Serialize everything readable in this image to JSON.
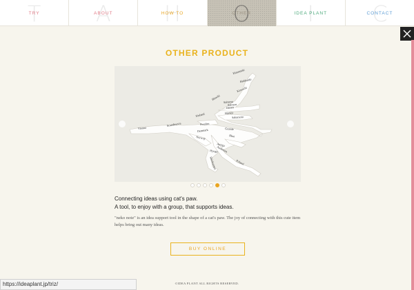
{
  "nav": {
    "items": [
      {
        "letter": "T",
        "label": "TRY",
        "color": "#e07a86"
      },
      {
        "letter": "A",
        "label": "ABOUT",
        "color": "#e07a86"
      },
      {
        "letter": "H",
        "label": "HOW TO",
        "color": "#e9a520"
      },
      {
        "letter": "O",
        "label": "OTHER",
        "color": "#9a9281"
      },
      {
        "letter": "I",
        "label": "IDEA PLANT",
        "color": "#4aa87a"
      },
      {
        "letter": "C",
        "label": "CONTACT",
        "color": "#5a9bd4"
      }
    ],
    "active_index": 3
  },
  "close_icon": "close-x-icon",
  "heading": "OTHER PRODUCT",
  "colors": {
    "accent": "#e9b21c",
    "edge": "#e58c9a"
  },
  "slider": {
    "dots": 6,
    "active_dot": 5,
    "words": [
      "Hanamaki",
      "Hokkaido",
      "Hitachi",
      "Kawachi",
      "Saitama",
      "Himeji",
      "Onsen",
      "Salmon",
      "Sakamoto",
      "Finland",
      "Scandinavia",
      "Sweden",
      "Denmark",
      "Norway",
      "Grande",
      "Blue",
      "Amiga",
      "Andersen",
      "Hyogo",
      "Poland",
      "Shinkansen",
      "Vienna"
    ]
  },
  "product": {
    "tagline_1": "Connecting ideas using cat's paw.",
    "tagline_2": "A tool, to enjoy with a group, that supports ideas.",
    "description": "\"neko note\" is an idea support tool in the shape of a cat's paw. The joy of connecting with this cute item helps bring out many ideas.",
    "buy_label": "BUY ONLINE"
  },
  "copyright": "©IDEA PLANT ALL RIGHTS RESERVED.",
  "status_url": "https://ideaplant.jp/triz/"
}
